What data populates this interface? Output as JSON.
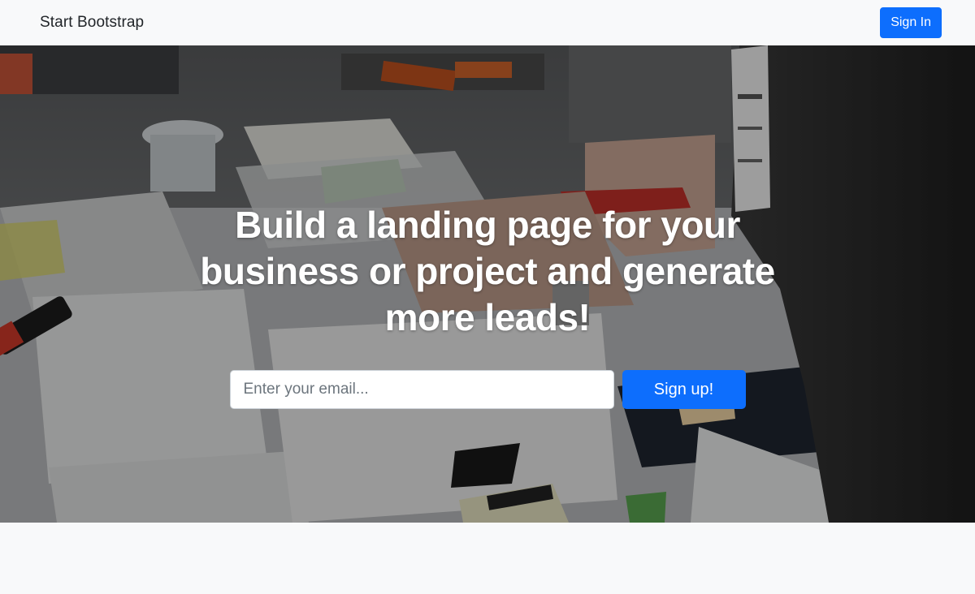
{
  "navbar": {
    "brand": "Start Bootstrap",
    "sign_in_label": "Sign In"
  },
  "hero": {
    "title": "Build a landing page for your business or project and generate more leads!",
    "email_placeholder": "Enter your email...",
    "email_value": "",
    "signup_label": "Sign up!",
    "background": "photo-of-people-working-on-paper-collages"
  },
  "colors": {
    "primary": "#0d6efd",
    "light_bg": "#f8f9fa"
  }
}
